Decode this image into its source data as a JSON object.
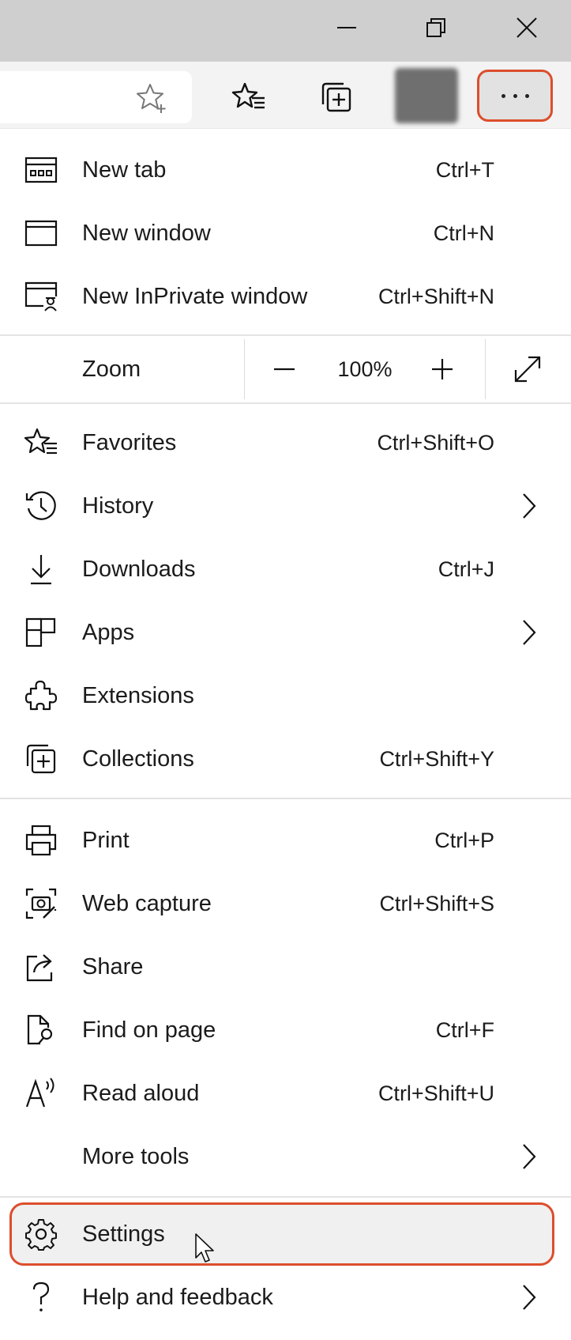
{
  "window_controls": {
    "minimize_icon": "minimize-icon",
    "restore_icon": "restore-icon",
    "close_icon": "close-icon"
  },
  "toolbar": {
    "add_favorite_icon": "star-plus-icon",
    "favorites_icon": "favorites-icon",
    "collections_icon": "collections-icon",
    "more_icon": "ellipsis-icon"
  },
  "menu": {
    "group1": [
      {
        "label": "New tab",
        "shortcut": "Ctrl+T",
        "icon": "new-tab-icon"
      },
      {
        "label": "New window",
        "shortcut": "Ctrl+N",
        "icon": "new-window-icon"
      },
      {
        "label": "New InPrivate window",
        "shortcut": "Ctrl+Shift+N",
        "icon": "inprivate-icon"
      }
    ],
    "zoom": {
      "label": "Zoom",
      "value": "100%",
      "minus_icon": "minus-icon",
      "plus_icon": "plus-icon",
      "fullscreen_icon": "fullscreen-icon"
    },
    "group2": [
      {
        "label": "Favorites",
        "shortcut": "Ctrl+Shift+O",
        "icon": "favorites-icon"
      },
      {
        "label": "History",
        "shortcut": "",
        "icon": "history-icon",
        "submenu": true
      },
      {
        "label": "Downloads",
        "shortcut": "Ctrl+J",
        "icon": "download-icon"
      },
      {
        "label": "Apps",
        "shortcut": "",
        "icon": "apps-icon",
        "submenu": true
      },
      {
        "label": "Extensions",
        "shortcut": "",
        "icon": "puzzle-icon"
      },
      {
        "label": "Collections",
        "shortcut": "Ctrl+Shift+Y",
        "icon": "collections-icon"
      }
    ],
    "group3": [
      {
        "label": "Print",
        "shortcut": "Ctrl+P",
        "icon": "printer-icon"
      },
      {
        "label": "Web capture",
        "shortcut": "Ctrl+Shift+S",
        "icon": "web-capture-icon"
      },
      {
        "label": "Share",
        "shortcut": "",
        "icon": "share-icon"
      },
      {
        "label": "Find on page",
        "shortcut": "Ctrl+F",
        "icon": "find-icon"
      },
      {
        "label": "Read aloud",
        "shortcut": "Ctrl+Shift+U",
        "icon": "read-aloud-icon"
      },
      {
        "label": "More tools",
        "shortcut": "",
        "icon": "",
        "submenu": true
      }
    ],
    "group4": [
      {
        "label": "Settings",
        "shortcut": "",
        "icon": "gear-icon",
        "highlighted": true
      },
      {
        "label": "Help and feedback",
        "shortcut": "",
        "icon": "help-icon",
        "submenu": true
      }
    ]
  },
  "colors": {
    "highlight_border": "#dc4e2c",
    "titlebar": "#cfcfcf",
    "toolbar": "#f3f3f3"
  }
}
